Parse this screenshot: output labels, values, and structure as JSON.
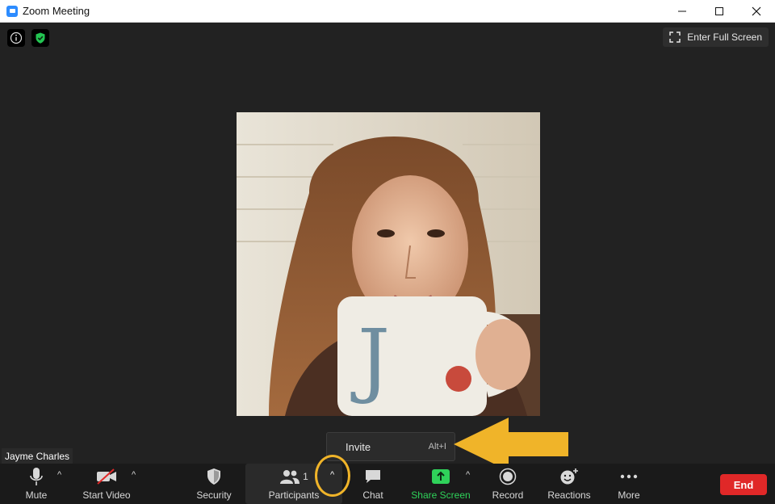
{
  "window": {
    "title": "Zoom Meeting",
    "controls": {
      "minimize": "—",
      "maximize": "☐",
      "close": "✕"
    }
  },
  "top_bar": {
    "fullscreen_label": "Enter Full Screen",
    "icons": [
      "info-icon",
      "shield-check-icon"
    ]
  },
  "participant": {
    "name": "Jayme Charles"
  },
  "popup": {
    "invite_label": "Invite",
    "invite_shortcut": "Alt+I"
  },
  "toolbar": {
    "mute_label": "Mute",
    "start_video_label": "Start Video",
    "security_label": "Security",
    "participants_label": "Participants",
    "participants_count": "1",
    "chat_label": "Chat",
    "share_screen_label": "Share Screen",
    "record_label": "Record",
    "reactions_label": "Reactions",
    "more_label": "More",
    "end_label": "End"
  },
  "colors": {
    "accent_green": "#2fd25a",
    "end_red": "#e02828",
    "annotation_yellow": "#f0b429",
    "zoom_blue": "#2d8cff"
  }
}
